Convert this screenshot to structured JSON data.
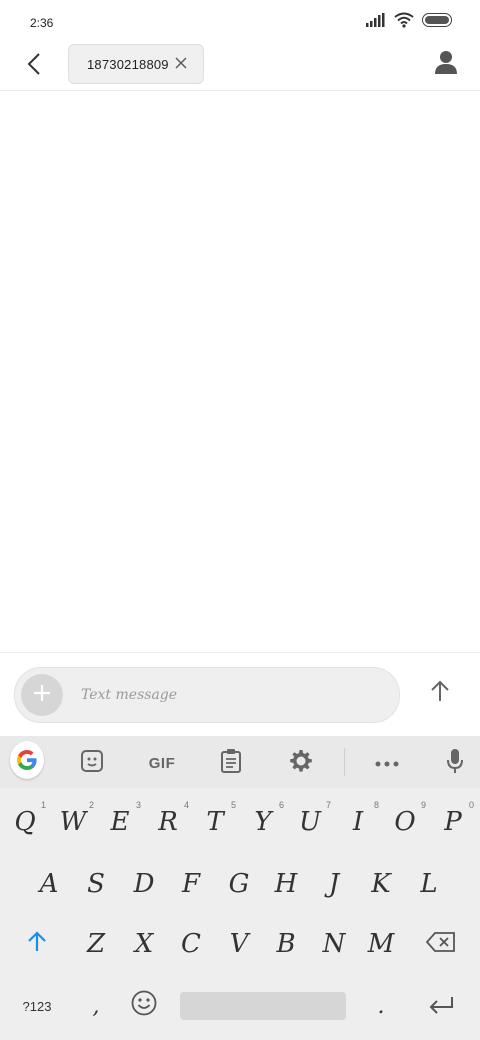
{
  "status": {
    "time": "2:36",
    "icons": [
      "signal-icon",
      "wifi-icon",
      "battery-icon"
    ]
  },
  "header": {
    "recipient": "18730218809",
    "back_icon": "back-icon",
    "remove_icon": "close-icon",
    "contact_icon": "person-icon"
  },
  "composer": {
    "placeholder": "Text message",
    "add_icon": "plus-icon",
    "send_icon": "send-arrow-icon"
  },
  "keyboard": {
    "toolbar": {
      "gif_label": "GIF",
      "icons": [
        "google-icon",
        "sticker-icon",
        "clipboard-icon",
        "settings-icon",
        "more-icon",
        "mic-icon"
      ]
    },
    "row1": [
      {
        "k": "Q",
        "h": "1"
      },
      {
        "k": "W",
        "h": "2"
      },
      {
        "k": "E",
        "h": "3"
      },
      {
        "k": "R",
        "h": "4"
      },
      {
        "k": "T",
        "h": "5"
      },
      {
        "k": "Y",
        "h": "6"
      },
      {
        "k": "U",
        "h": "7"
      },
      {
        "k": "I",
        "h": "8"
      },
      {
        "k": "O",
        "h": "9"
      },
      {
        "k": "P",
        "h": "0"
      }
    ],
    "row2": [
      "A",
      "S",
      "D",
      "F",
      "G",
      "H",
      "J",
      "K",
      "L"
    ],
    "row3": [
      "Z",
      "X",
      "C",
      "V",
      "B",
      "N",
      "M"
    ],
    "row4": {
      "symbols": "?123",
      "comma": ",",
      "period": "."
    }
  }
}
